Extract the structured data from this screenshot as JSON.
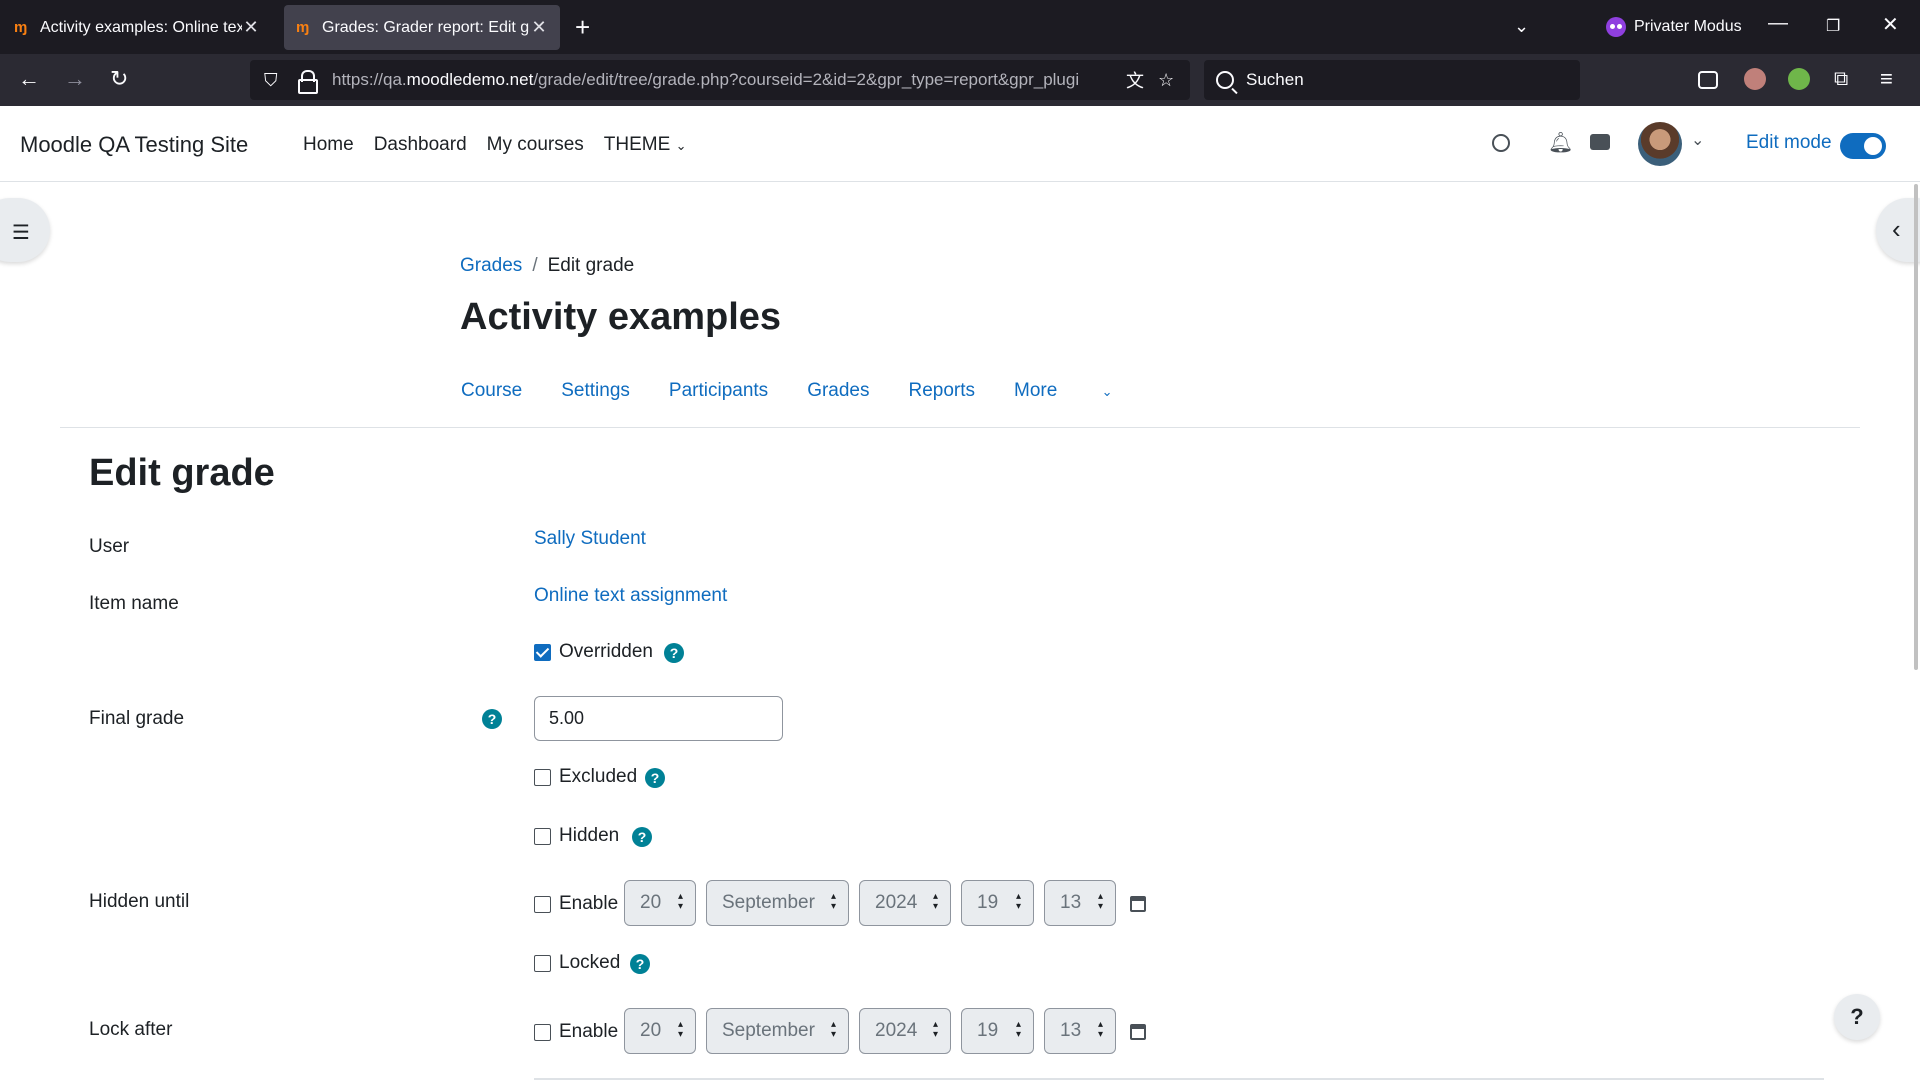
{
  "browser": {
    "tabs": [
      {
        "title": "Activity examples: Online text a",
        "active": false
      },
      {
        "title": "Grades: Grader report: Edit grad",
        "active": true
      }
    ],
    "private_label": "Privater Modus",
    "url_prefix": "https://qa.",
    "url_domain": "moodledemo.net",
    "url_rest": "/grade/edit/tree/grade.php?courseid=2&id=2&gpr_type=report&gpr_plugi",
    "search_placeholder": "Suchen"
  },
  "site": {
    "name": "Moodle QA Testing Site",
    "nav": [
      "Home",
      "Dashboard",
      "My courses",
      "THEME"
    ],
    "edit_mode_label": "Edit mode",
    "edit_mode_on": true
  },
  "breadcrumb": {
    "parent": "Grades",
    "separator": "/",
    "current": "Edit grade"
  },
  "course_title": "Activity examples",
  "secondary_nav": [
    "Course",
    "Settings",
    "Participants",
    "Grades",
    "Reports",
    "More"
  ],
  "page_heading": "Edit grade",
  "form": {
    "user_label": "User",
    "user_value": "Sally Student",
    "item_label": "Item name",
    "item_value": "Online text assignment",
    "overridden_label": "Overridden",
    "overridden_checked": true,
    "final_grade_label": "Final grade",
    "final_grade_value": "5.00",
    "excluded_label": "Excluded",
    "hidden_label": "Hidden",
    "hidden_until_label": "Hidden until",
    "hidden_until": {
      "enable_label": "Enable",
      "day": "20",
      "month": "September",
      "year": "2024",
      "hour": "19",
      "minute": "13"
    },
    "locked_label": "Locked",
    "lock_after_label": "Lock after",
    "lock_after": {
      "enable_label": "Enable",
      "day": "20",
      "month": "September",
      "year": "2024",
      "hour": "19",
      "minute": "13"
    }
  },
  "help_button": "?",
  "colors": {
    "link": "#0f6cbf",
    "help_icon": "#008196",
    "browser_dark": "#1c1b22"
  }
}
